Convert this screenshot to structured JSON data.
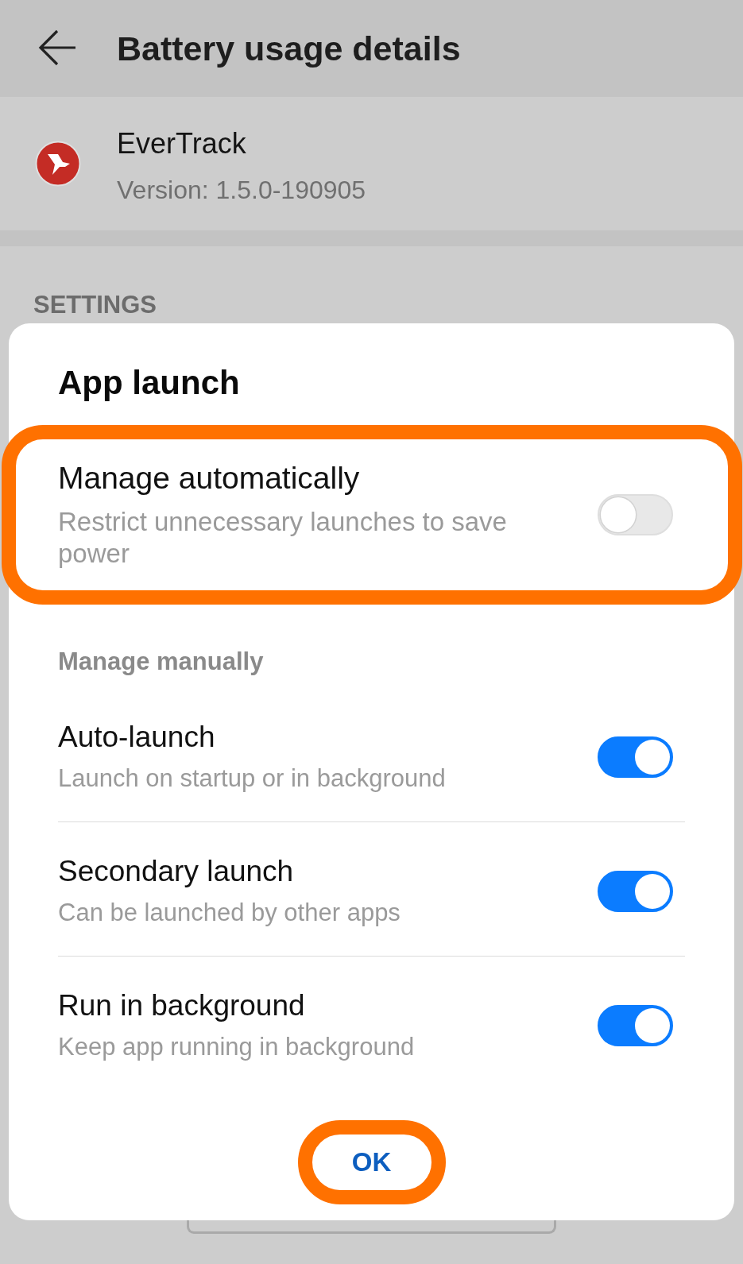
{
  "header": {
    "title": "Battery usage details"
  },
  "app": {
    "name": "EverTrack",
    "version": "Version: 1.5.0-190905"
  },
  "section_label": "SETTINGS",
  "dialog": {
    "title": "App launch",
    "automatic": {
      "title": "Manage automatically",
      "subtitle": "Restrict unnecessary launches to save power",
      "on": false,
      "highlighted": true
    },
    "manual_label": "Manage manually",
    "options": [
      {
        "title": "Auto-launch",
        "subtitle": "Launch on startup or in background",
        "on": true
      },
      {
        "title": "Secondary launch",
        "subtitle": "Can be launched by other apps",
        "on": true
      },
      {
        "title": "Run in background",
        "subtitle": "Keep app running in background",
        "on": true
      }
    ],
    "button": {
      "label": "OK",
      "highlighted": true
    }
  }
}
